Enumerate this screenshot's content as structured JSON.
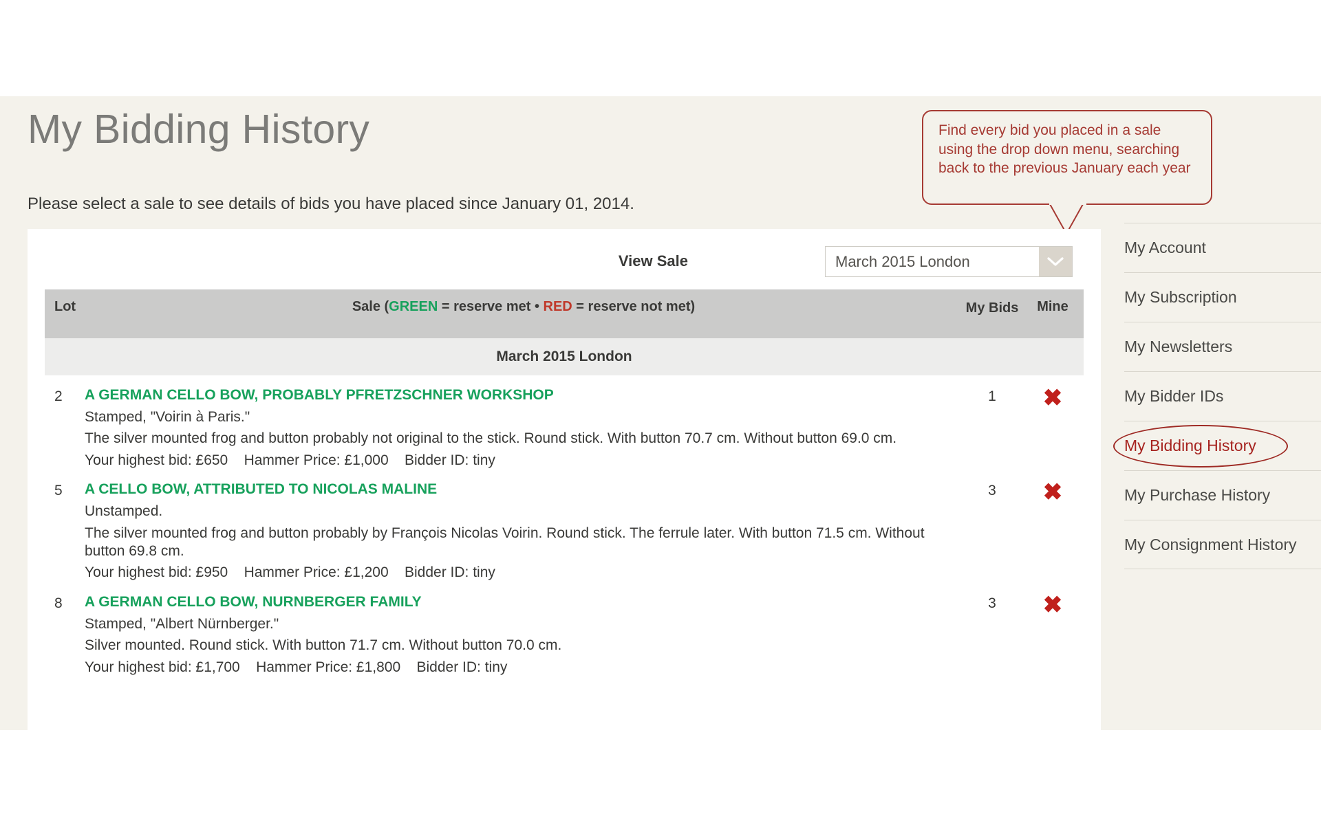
{
  "header": {
    "title": "My Bidding History",
    "intro": "Please select a sale to see details of bids you have placed since January 01, 2014."
  },
  "callout": {
    "text": "Find every bid you placed in a sale using the drop down menu,  searching back to the previous January each year",
    "border_color": "#a63a33",
    "text_color": "#a63a33"
  },
  "sale_selector": {
    "label": "View Sale",
    "value": "March 2015 London",
    "arrow_icon": "chevron-down-icon"
  },
  "table": {
    "headers": {
      "lot": "Lot",
      "sale_prefix": "Sale (",
      "sale_green": "GREEN",
      "sale_mid": " = reserve met • ",
      "sale_red": "RED",
      "sale_suffix": " = reserve not met)",
      "my_bids": "My Bids",
      "mine": "Mine"
    },
    "group_label": "March 2015 London",
    "rows": [
      {
        "lot": "2",
        "title": "A GERMAN CELLO BOW, PROBABLY PFRETZSCHNER WORKSHOP",
        "stamp": "Stamped, \"Voirin à Paris.\"",
        "description": "The silver mounted frog and button probably not original to the stick. Round stick. With button 70.7 cm. Without button 69.0 cm.",
        "bid_line": "Your highest bid: £650    Hammer Price: £1,000    Bidder ID: tiny",
        "my_bids": "1",
        "mine_icon": "x-mark-icon"
      },
      {
        "lot": "5",
        "title": "A CELLO BOW, ATTRIBUTED TO NICOLAS MALINE",
        "stamp": "Unstamped.",
        "description": "The silver mounted frog and button probably by François Nicolas Voirin. Round stick. The ferrule later. With button 71.5 cm. Without button 69.8 cm.",
        "bid_line": "Your highest bid: £950    Hammer Price: £1,200    Bidder ID: tiny",
        "my_bids": "3",
        "mine_icon": "x-mark-icon"
      },
      {
        "lot": "8",
        "title": "A GERMAN CELLO BOW, NURNBERGER FAMILY",
        "stamp": "Stamped, \"Albert Nürnberger.\"",
        "description": "Silver mounted. Round stick. With button 71.7 cm. Without button 70.0 cm.",
        "bid_line": "Your highest bid: £1,700    Hammer Price: £1,800    Bidder ID: tiny",
        "my_bids": "3",
        "mine_icon": "x-mark-icon"
      }
    ]
  },
  "sidebar": {
    "items": [
      {
        "label": "My Account",
        "active": false
      },
      {
        "label": "My Subscription",
        "active": false
      },
      {
        "label": "My Newsletters",
        "active": false
      },
      {
        "label": "My Bidder IDs",
        "active": false
      },
      {
        "label": "My Bidding History",
        "active": true
      },
      {
        "label": "My Purchase History",
        "active": false
      },
      {
        "label": "My Consignment History",
        "active": false
      }
    ]
  },
  "colors": {
    "page_background": "#f4f2eb",
    "content_background": "#ffffff",
    "green": "#17a15c",
    "red": "#c0392b",
    "x_mark_red": "#c0201c",
    "annotation_red": "#a63a33",
    "table_header": "#cbcbca",
    "group_row": "#ededec"
  }
}
